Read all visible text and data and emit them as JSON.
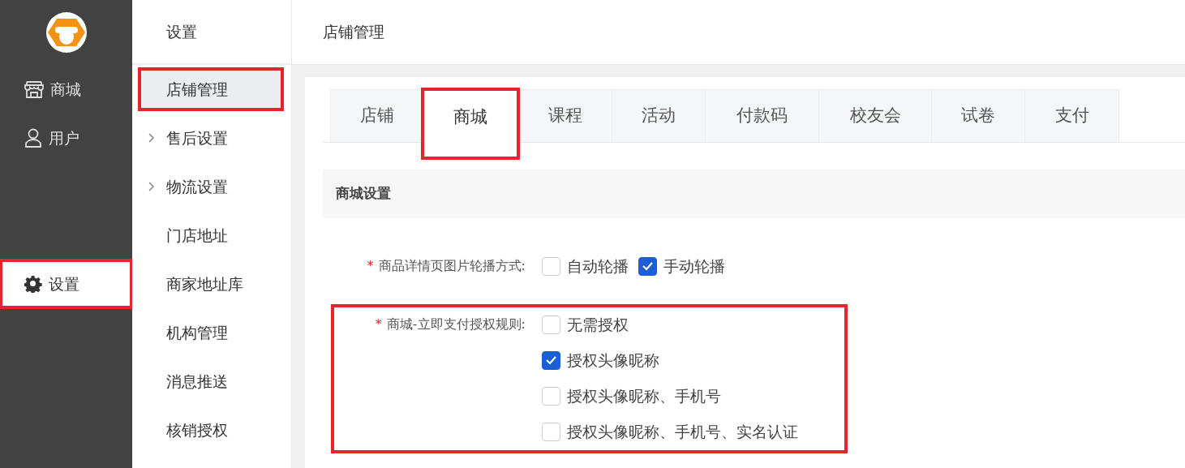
{
  "sidebar": {
    "items": [
      {
        "label": "商城",
        "kind": "store",
        "selected": false,
        "highlighted": false
      },
      {
        "label": "用户",
        "kind": "user",
        "selected": false,
        "highlighted": false
      },
      {
        "label": "设置",
        "kind": "settings",
        "selected": true,
        "highlighted": true
      }
    ]
  },
  "submenu": {
    "title": "设置",
    "items": [
      {
        "label": "店铺管理",
        "expandable": false,
        "selected": true,
        "highlighted": true
      },
      {
        "label": "售后设置",
        "expandable": true,
        "selected": false,
        "highlighted": false
      },
      {
        "label": "物流设置",
        "expandable": true,
        "selected": false,
        "highlighted": false
      },
      {
        "label": "门店地址",
        "expandable": false,
        "selected": false,
        "highlighted": false
      },
      {
        "label": "商家地址库",
        "expandable": false,
        "selected": false,
        "highlighted": false
      },
      {
        "label": "机构管理",
        "expandable": false,
        "selected": false,
        "highlighted": false
      },
      {
        "label": "消息推送",
        "expandable": false,
        "selected": false,
        "highlighted": false
      },
      {
        "label": "核销授权",
        "expandable": false,
        "selected": false,
        "highlighted": false
      }
    ]
  },
  "header": {
    "title": "店铺管理"
  },
  "tabs": [
    {
      "label": "店铺",
      "selected": false,
      "highlighted": false
    },
    {
      "label": "商城",
      "selected": true,
      "highlighted": true
    },
    {
      "label": "课程",
      "selected": false,
      "highlighted": false
    },
    {
      "label": "活动",
      "selected": false,
      "highlighted": false
    },
    {
      "label": "付款码",
      "selected": false,
      "highlighted": false
    },
    {
      "label": "校友会",
      "selected": false,
      "highlighted": false
    },
    {
      "label": "试卷",
      "selected": false,
      "highlighted": false
    },
    {
      "label": "支付",
      "selected": false,
      "highlighted": false
    }
  ],
  "section": {
    "title": "商城设置",
    "fields": [
      {
        "required_mark": "*",
        "label": "商品详情页图片轮播方式:",
        "kind": "inline",
        "highlighted": false,
        "options": [
          {
            "label": "自动轮播",
            "checked": false
          },
          {
            "label": "手动轮播",
            "checked": true
          }
        ]
      },
      {
        "required_mark": "*",
        "label": "商城-立即支付授权规则:",
        "kind": "stacked",
        "highlighted": true,
        "options": [
          {
            "label": "无需授权",
            "checked": false
          },
          {
            "label": "授权头像昵称",
            "checked": true
          },
          {
            "label": "授权头像昵称、手机号",
            "checked": false
          },
          {
            "label": "授权头像昵称、手机号、实名认证",
            "checked": false
          }
        ]
      }
    ]
  }
}
